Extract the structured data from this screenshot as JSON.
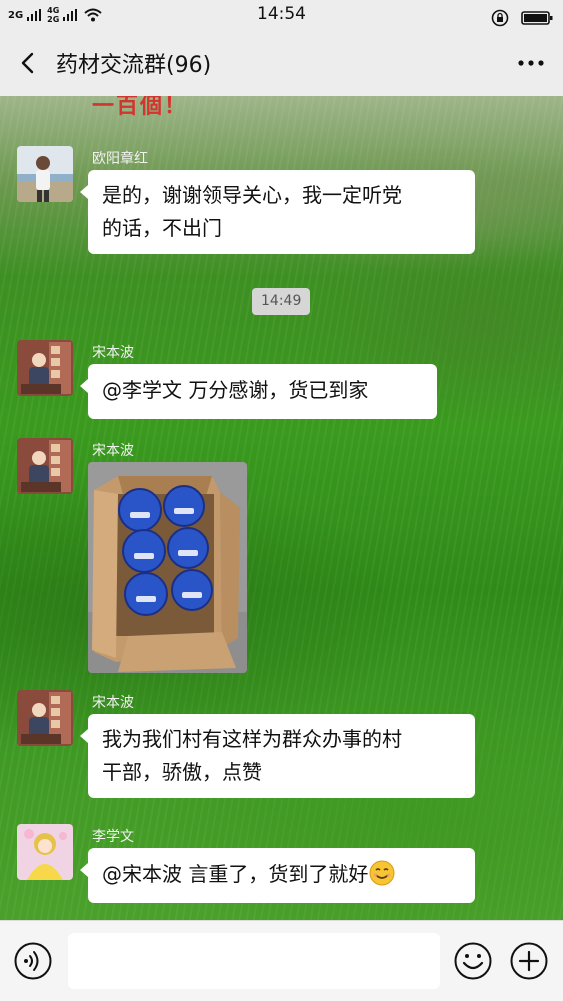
{
  "status_bar": {
    "network_1": "2G",
    "network_2a": "4G",
    "network_2b": "2G",
    "time": "14:54"
  },
  "nav": {
    "title": "药材交流群(96)"
  },
  "wallpaper": {
    "sign_text": "一百個！"
  },
  "messages": [
    {
      "sender": "欧阳章红",
      "lines": [
        "是的，谢谢领导关心，我一定听党",
        "的话，不出门"
      ]
    },
    {
      "type": "time",
      "text": "14:49"
    },
    {
      "sender": "宋本波",
      "lines": [
        "@李学文  万分感谢，货已到家"
      ]
    },
    {
      "sender": "宋本波",
      "type": "image"
    },
    {
      "sender": "宋本波",
      "lines": [
        "我为我们村有这样为群众办事的村",
        "干部，骄傲，点赞"
      ]
    },
    {
      "sender": "李学文",
      "lines": [
        "@宋本波  言重了，货到了就好"
      ]
    }
  ],
  "input": {
    "value": "",
    "placeholder": ""
  },
  "colors": {
    "nav_bg": "#ededed",
    "bubble_bg": "#ffffff",
    "time_pill_bg": "#d6d6d6",
    "input_bar_bg": "#f5f5f5"
  },
  "icons": {
    "back": "chevron-left-icon",
    "more": "more-dots-icon",
    "voice": "voice-icon",
    "emoji": "emoji-icon",
    "plus": "plus-icon",
    "smiley": "smiley-emoji-icon"
  }
}
